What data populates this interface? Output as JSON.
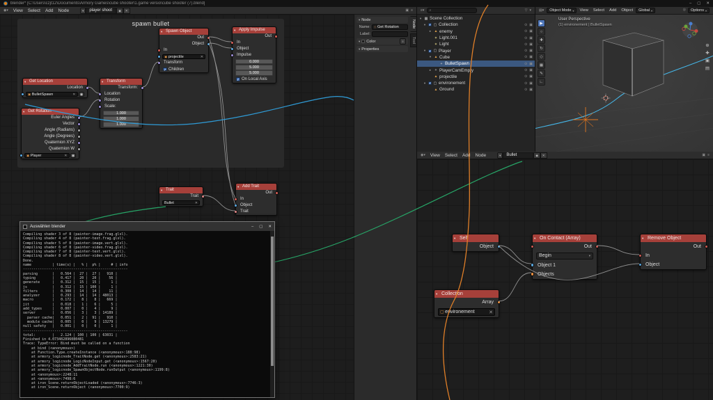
{
  "window": {
    "title": "blender* [C:\\Users\\czjt12\\Documents\\Armory Games\\cube shooter\\1.game versio\\cube shooter (7).blend]",
    "minimize": "–",
    "maximize": "▢",
    "close": "✕"
  },
  "left_editor": {
    "menus": [
      "View",
      "Select",
      "Add",
      "Node"
    ],
    "tree_name": "player shoot",
    "frame_title": "spawn bullet",
    "nodes": {
      "get_location": {
        "title": "Get Location",
        "output": "Location",
        "object": "BulletSpawn"
      },
      "transform": {
        "title": "Transform",
        "output": "Transform:",
        "in1": "Location",
        "in2": "Rotation",
        "in3": "Scale:",
        "v1": "1.000",
        "v2": "1.000",
        "v3": "1.000"
      },
      "get_rotation": {
        "title": "Get Rotation",
        "o1": "Euler Angles",
        "o2": "Vector",
        "o3": "Angle (Radians)",
        "o4": "Angle (Degrees)",
        "o5": "Quaternion XYZ",
        "o6": "Quaternion W",
        "object": "Player"
      },
      "spawn_object": {
        "title": "Spawn Object",
        "o1": "Out",
        "o2": "Object",
        "i1": "In",
        "object": "projectile",
        "i2": "Transform",
        "check": "Children"
      },
      "apply_impulse": {
        "title": "Apply Impulse",
        "o1": "Out",
        "i1": "In",
        "i2": "Object",
        "i3": "Impulse",
        "v1": "0.000",
        "v2": "5.000",
        "v3": "5.000",
        "check": "On Local Axis"
      },
      "trait": {
        "title": "Trait",
        "o1": "Trait",
        "value": "Bullet"
      },
      "add_trait": {
        "title": "Add Trait",
        "o1": "Out",
        "i1": "In",
        "i2": "Object",
        "i3": "Trait"
      }
    }
  },
  "sidebar": {
    "tabs": [
      "Node",
      "Tool"
    ],
    "node_section": "Node",
    "name_label": "Name:",
    "name_value": "Get Rotation",
    "label_label": "Label:",
    "label_value": "",
    "color_section": "Color",
    "properties_section": "Properties"
  },
  "outliner": {
    "rows": [
      {
        "label": "Scene Collection"
      },
      {
        "label": "Collection"
      },
      {
        "label": "enemy"
      },
      {
        "label": "Light.001"
      },
      {
        "label": "Light"
      },
      {
        "label": "Player"
      },
      {
        "label": "Cube"
      },
      {
        "label": "BulletSpawn"
      },
      {
        "label": "PlayerCamEmpty"
      },
      {
        "label": "projectile"
      },
      {
        "label": "environement"
      },
      {
        "label": "Ground"
      }
    ]
  },
  "viewport": {
    "mode": "Object Mode",
    "menus": [
      "View",
      "Select",
      "Add",
      "Object"
    ],
    "orientation": "Global",
    "options": "Options",
    "overlay1": "User Perspective",
    "overlay2": "(1) environement | BulletSpawn"
  },
  "bottom_editor": {
    "menus": [
      "View",
      "Select",
      "Add",
      "Node"
    ],
    "tree_name": "Bullet",
    "nodes": {
      "self": {
        "title": "Self",
        "o1": "Object"
      },
      "on_contact": {
        "title": "On Contact (Array)",
        "o1": "Out",
        "dropdown": "Begin",
        "i1": "Object 1",
        "i2": "Objects"
      },
      "remove_object": {
        "title": "Remove Object",
        "o1": "Out",
        "i1": "In",
        "i2": "Object"
      },
      "collection": {
        "title": "Collection",
        "o1": "Array",
        "value": "environement"
      }
    }
  },
  "console": {
    "title": "Auswählen blender",
    "content": "Compiling shader 3 of 8 (painter-image.frag.glsl).\nCompiling shader 4 of 8 (painter-text.frag.glsl).\nCompiling shader 5 of 8 (painter-image.vert.glsl).\nCompiling shader 6 of 8 (painter-video.frag.glsl).\nCompiling shader 7 of 8 (painter-text.vert.glsl).\nCompiling shader 8 of 8 (painter-video.vert.glsl).\nDone.\nname          | time(s) |   % |  p% |     # | info\n--------------------------------------------------\nparsing       |   0.564 |  27 |  27 |   910 |\ntyping        |   0.417 |  20 |  20 |    56 |\ngenerate      |   0.312 |  15 |  15 |     1 |\njs            |   0.312 |  15 | 100 |     1 |\nfilters       |   0.308 |  14 |  14 |    11 |\nanalyzer      |   0.293 |  14 |  14 | 48013 |\nmacro         |   0.172 |   8 |   8 |   669 |\njit           |   0.018 |   1 |   6 |     5 |\nadd_types     |   0.007 |   0 |   4 |     9 |\nserver        |   0.056 |   3 |   3 | 14189 |\n  parser cache|   0.051 |   2 |  91 |   910 |\n  module cache|   0.005 |   0 |   9 | 13279 |\nnull safety   |   0.001 |   0 |   0 |     1 |\n--------------------------------------------------\ntotal:        |   2.124 | 100 | 100 | 63031 |\nFinished in 4.073482896080481\nTrace: TypeError: Bind must be called on a function\n    at bind (<anonymous>)\n    at Function.Type.createInstance (<anonymous>:188:98)\n    at armory_logicnode_TraitNode.get (<anonymous>:2583:21)\n    at armory_logicnode_LogicNodeInput.get (<anonymous>:1567:20)\n    at armory_logicnode_AddTraitNode.run (<anonymous>:1221:30)\n    at armory_logicnode_SpawnObjectNode.runOutput (<anonymous>:1199:8)\n    at <anonymous>:2248:11\n    at <anonymous>:7498:6\n    at iron_Scene.returnObjectLoaded (<anonymous>:7746:3)\n    at iron_Scene.returnObject (<anonymous>:7700:9)"
  }
}
